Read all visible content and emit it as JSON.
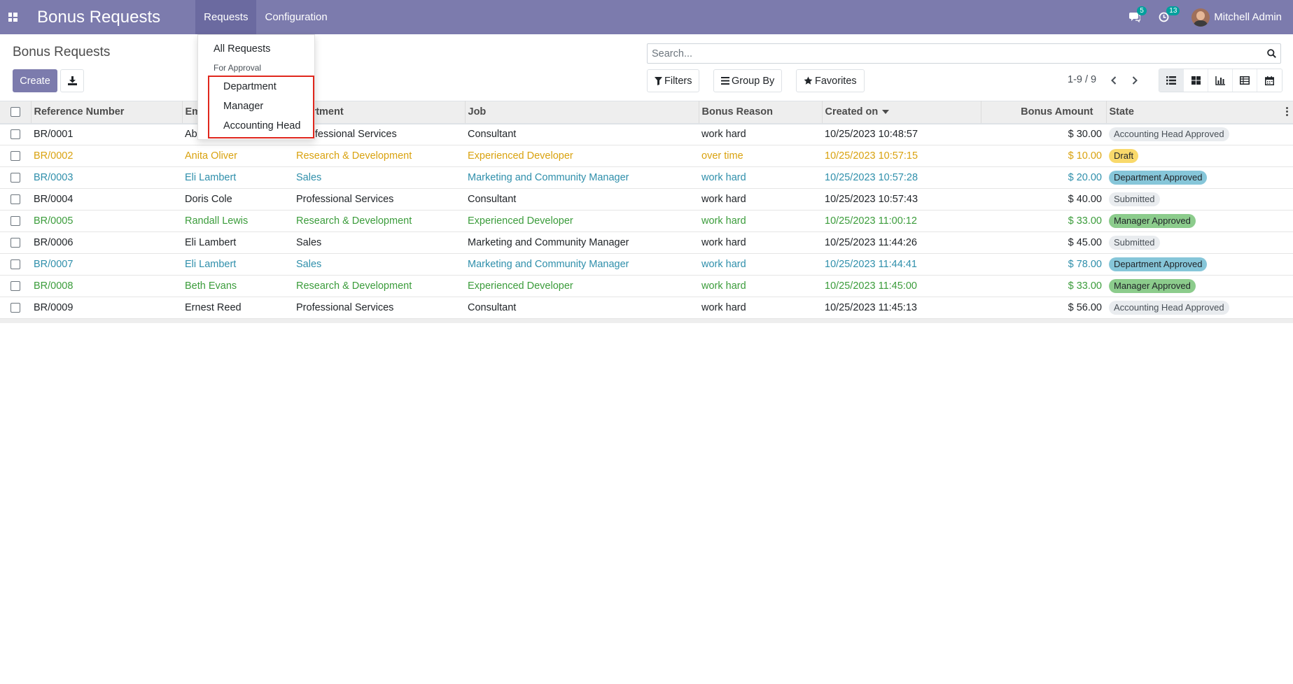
{
  "app": {
    "title": "Bonus Requests"
  },
  "nav": {
    "menu": [
      {
        "label": "Requests",
        "active": true
      },
      {
        "label": "Configuration",
        "active": false
      }
    ],
    "messages_count": "5",
    "activity_count": "13",
    "user_name": "Mitchell Admin",
    "accent_color": "#7c7bad"
  },
  "dropdown": {
    "all_requests": "All Requests",
    "section_header": "For Approval",
    "items": [
      "Department",
      "Manager",
      "Accounting Head"
    ]
  },
  "control_panel": {
    "breadcrumb": "Bonus Requests",
    "create_label": "Create",
    "search_placeholder": "Search...",
    "filters_label": "Filters",
    "group_by_label": "Group By",
    "favorites_label": "Favorites",
    "pager": "1-9 / 9"
  },
  "table": {
    "headers": [
      "Reference Number",
      "Employee",
      "Department",
      "Job",
      "Bonus Reason",
      "Created on",
      "Bonus Amount",
      "State"
    ],
    "visible_headers": [
      "Reference Number",
      "Em",
      "artment",
      "Job",
      "Bonus Reason",
      "Created on",
      "Bonus Amount",
      "State"
    ],
    "rows": [
      {
        "ref": "BR/0001",
        "employee": "Ab",
        "department": "rofessional Services",
        "job": "Consultant",
        "reason": "work hard",
        "created": "10/25/2023 10:48:57",
        "amount": "$ 30.00",
        "state": "Accounting Head Approved",
        "style": "plain",
        "badge": "b-ah"
      },
      {
        "ref": "BR/0002",
        "employee": "Anita Oliver",
        "department": "Research & Development",
        "job": "Experienced Developer",
        "reason": "over time",
        "created": "10/25/2023 10:57:15",
        "amount": "$ 10.00",
        "state": "Draft",
        "style": "draft",
        "badge": "b-draft"
      },
      {
        "ref": "BR/0003",
        "employee": "Eli Lambert",
        "department": "Sales",
        "job": "Marketing and Community Manager",
        "reason": "work hard",
        "created": "10/25/2023 10:57:28",
        "amount": "$ 20.00",
        "state": "Department Approved",
        "style": "dept",
        "badge": "b-dept"
      },
      {
        "ref": "BR/0004",
        "employee": "Doris Cole",
        "department": "Professional Services",
        "job": "Consultant",
        "reason": "work hard",
        "created": "10/25/2023 10:57:43",
        "amount": "$ 40.00",
        "state": "Submitted",
        "style": "plain",
        "badge": "b-sub"
      },
      {
        "ref": "BR/0005",
        "employee": "Randall Lewis",
        "department": "Research & Development",
        "job": "Experienced Developer",
        "reason": "work hard",
        "created": "10/25/2023 11:00:12",
        "amount": "$ 33.00",
        "state": "Manager Approved",
        "style": "mgr",
        "badge": "b-mgr"
      },
      {
        "ref": "BR/0006",
        "employee": "Eli Lambert",
        "department": "Sales",
        "job": "Marketing and Community Manager",
        "reason": "work hard",
        "created": "10/25/2023 11:44:26",
        "amount": "$ 45.00",
        "state": "Submitted",
        "style": "plain",
        "badge": "b-sub"
      },
      {
        "ref": "BR/0007",
        "employee": "Eli Lambert",
        "department": "Sales",
        "job": "Marketing and Community Manager",
        "reason": "work hard",
        "created": "10/25/2023 11:44:41",
        "amount": "$ 78.00",
        "state": "Department Approved",
        "style": "dept",
        "badge": "b-dept"
      },
      {
        "ref": "BR/0008",
        "employee": "Beth Evans",
        "department": "Research & Development",
        "job": "Experienced Developer",
        "reason": "work hard",
        "created": "10/25/2023 11:45:00",
        "amount": "$ 33.00",
        "state": "Manager Approved",
        "style": "mgr",
        "badge": "b-mgr"
      },
      {
        "ref": "BR/0009",
        "employee": "Ernest Reed",
        "department": "Professional Services",
        "job": "Consultant",
        "reason": "work hard",
        "created": "10/25/2023 11:45:13",
        "amount": "$ 56.00",
        "state": "Accounting Head Approved",
        "style": "plain",
        "badge": "b-ah"
      }
    ]
  }
}
